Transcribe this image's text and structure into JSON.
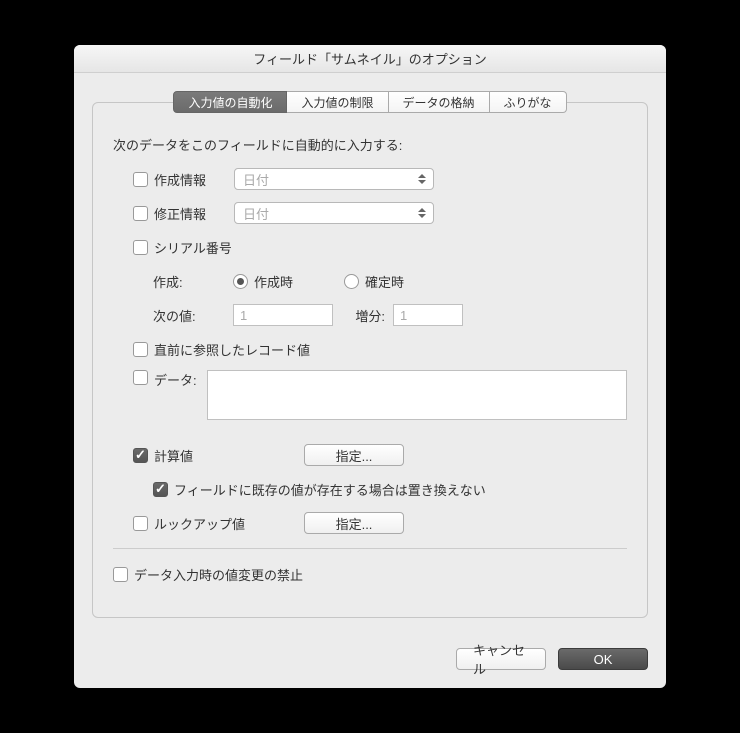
{
  "title": "フィールド「サムネイル」のオプション",
  "tabs": [
    "入力値の自動化",
    "入力値の制限",
    "データの格納",
    "ふりがな"
  ],
  "desc": "次のデータをこのフィールドに自動的に入力する:",
  "creation": {
    "label": "作成情報",
    "select": "日付"
  },
  "modification": {
    "label": "修正情報",
    "select": "日付"
  },
  "serial": {
    "label": "シリアル番号",
    "generate_label": "作成:",
    "on_creation": "作成時",
    "on_commit": "確定時",
    "next_label": "次の値:",
    "next_value": "1",
    "increment_label": "増分:",
    "increment_value": "1"
  },
  "last_visited": "直前に参照したレコード値",
  "data_label": "データ:",
  "calculated": {
    "label": "計算値",
    "specify": "指定..."
  },
  "do_not_replace": "フィールドに既存の値が存在する場合は置き換えない",
  "lookup": {
    "label": "ルックアップ値",
    "specify": "指定..."
  },
  "prohibit": "データ入力時の値変更の禁止",
  "buttons": {
    "cancel": "キャンセル",
    "ok": "OK"
  }
}
